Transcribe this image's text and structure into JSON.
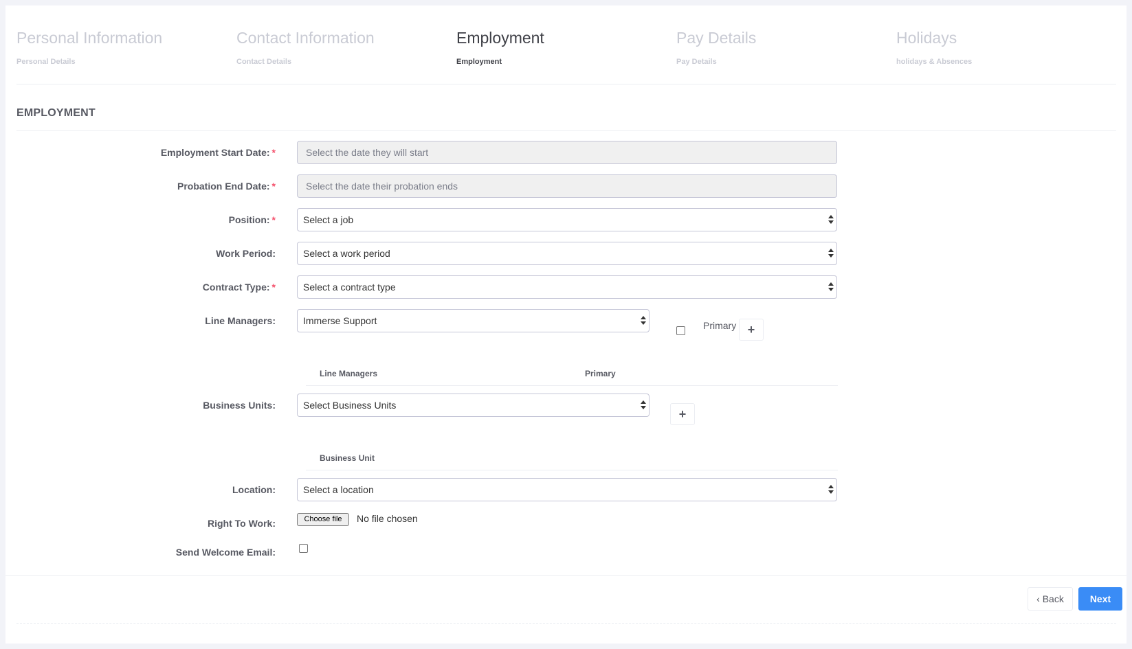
{
  "wizard": {
    "steps": [
      {
        "title": "Personal Information",
        "subtitle": "Personal Details"
      },
      {
        "title": "Contact Information",
        "subtitle": "Contact Details"
      },
      {
        "title": "Employment",
        "subtitle": "Employment"
      },
      {
        "title": "Pay Details",
        "subtitle": "Pay Details"
      },
      {
        "title": "Holidays",
        "subtitle": "holidays & Absences"
      }
    ],
    "active_index": 2
  },
  "section": {
    "title": "EMPLOYMENT"
  },
  "form": {
    "start_date": {
      "label": "Employment Start Date:",
      "placeholder": "Select the date they will start"
    },
    "probation_end": {
      "label": "Probation End Date:",
      "placeholder": "Select the date their probation ends"
    },
    "position": {
      "label": "Position:",
      "value": "Select a job"
    },
    "work_period": {
      "label": "Work Period:",
      "value": "Select a work period"
    },
    "contract_type": {
      "label": "Contract Type:",
      "value": "Select a contract type"
    },
    "line_managers": {
      "label": "Line Managers:",
      "value": "Immerse Support",
      "primary_label": "Primary",
      "add_label": "+",
      "table_headers": [
        "Line Managers",
        "Primary"
      ]
    },
    "business_units": {
      "label": "Business Units:",
      "value": "Select Business Units",
      "add_label": "+",
      "table_headers": [
        "Business Unit"
      ]
    },
    "location": {
      "label": "Location:",
      "value": "Select a location"
    },
    "right_to_work": {
      "label": "Right To Work:",
      "button": "Choose file",
      "status": "No file chosen"
    },
    "welcome_email": {
      "label": "Send Welcome Email:"
    },
    "required_mark": "*"
  },
  "actions": {
    "back": "Back",
    "next": "Next",
    "back_icon": "‹",
    "next_icon": "›"
  }
}
